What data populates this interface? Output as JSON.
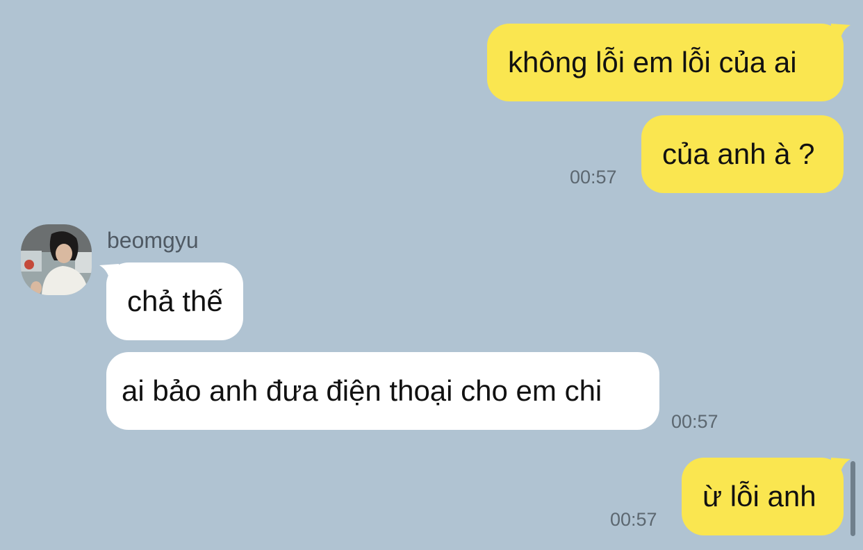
{
  "colors": {
    "background": "#b0c3d2",
    "outgoing_bubble": "#fae650",
    "incoming_bubble": "#ffffff",
    "timestamp": "#5c6770"
  },
  "contact": {
    "name": "beomgyu",
    "avatar_icon": "profile-photo"
  },
  "messages": [
    {
      "direction": "outgoing",
      "text": "không lỗi em lỗi của ai",
      "time": ""
    },
    {
      "direction": "outgoing",
      "text": "của anh à ?",
      "time": "00:57"
    },
    {
      "direction": "incoming",
      "text": "chả thế",
      "time": ""
    },
    {
      "direction": "incoming",
      "text": "ai bảo anh đưa điện thoại cho em chi",
      "time": "00:57"
    },
    {
      "direction": "outgoing",
      "text": "ừ lỗi anh",
      "time": "00:57"
    }
  ]
}
